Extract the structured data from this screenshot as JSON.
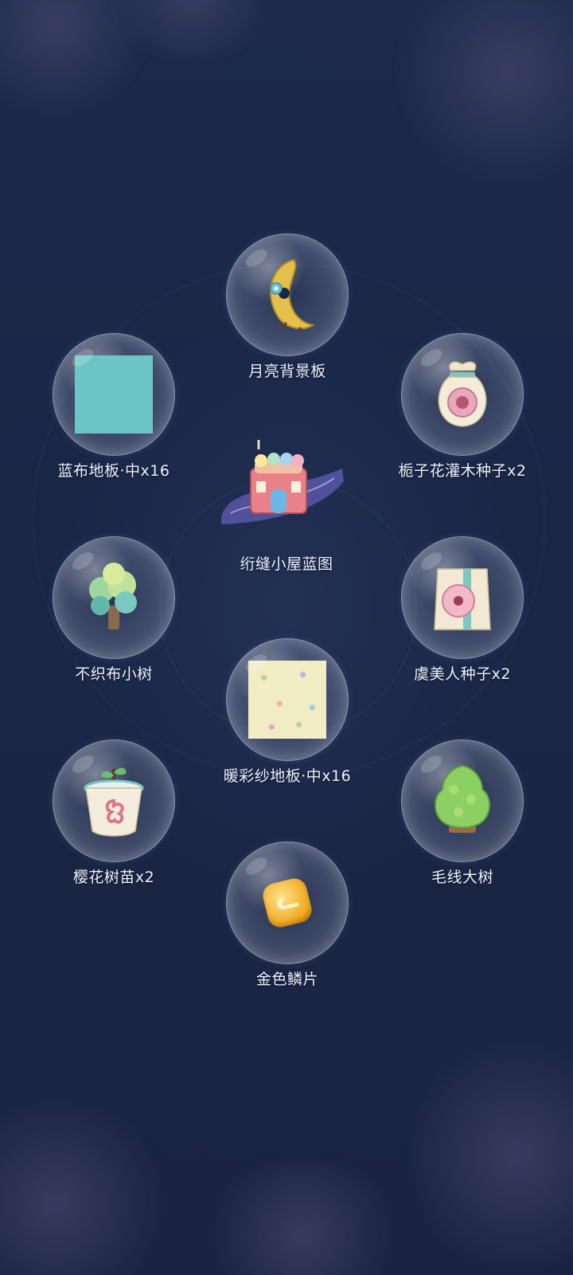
{
  "items": [
    {
      "label": "月亮背景板",
      "icon": "moon-backdrop-icon"
    },
    {
      "label": "蓝布地板·中x16",
      "icon": "blue-cloth-floor-icon",
      "color": "#6cc6c6"
    },
    {
      "label": "栀子花灌木种子x2",
      "icon": "gardenia-seed-bag-icon"
    },
    {
      "label": "绗缝小屋蓝图",
      "icon": "quilted-cottage-blueprint-icon"
    },
    {
      "label": "不织布小树",
      "icon": "felt-tree-icon"
    },
    {
      "label": "虞美人种子x2",
      "icon": "poppy-seed-packet-icon"
    },
    {
      "label": "暖彩纱地板·中x16",
      "icon": "warm-gauze-floor-icon",
      "color": "#f2ecc4"
    },
    {
      "label": "樱花树苗x2",
      "icon": "cherry-sapling-icon"
    },
    {
      "label": "毛线大树",
      "icon": "yarn-big-tree-icon"
    },
    {
      "label": "金色鳞片",
      "icon": "golden-scale-icon"
    }
  ]
}
